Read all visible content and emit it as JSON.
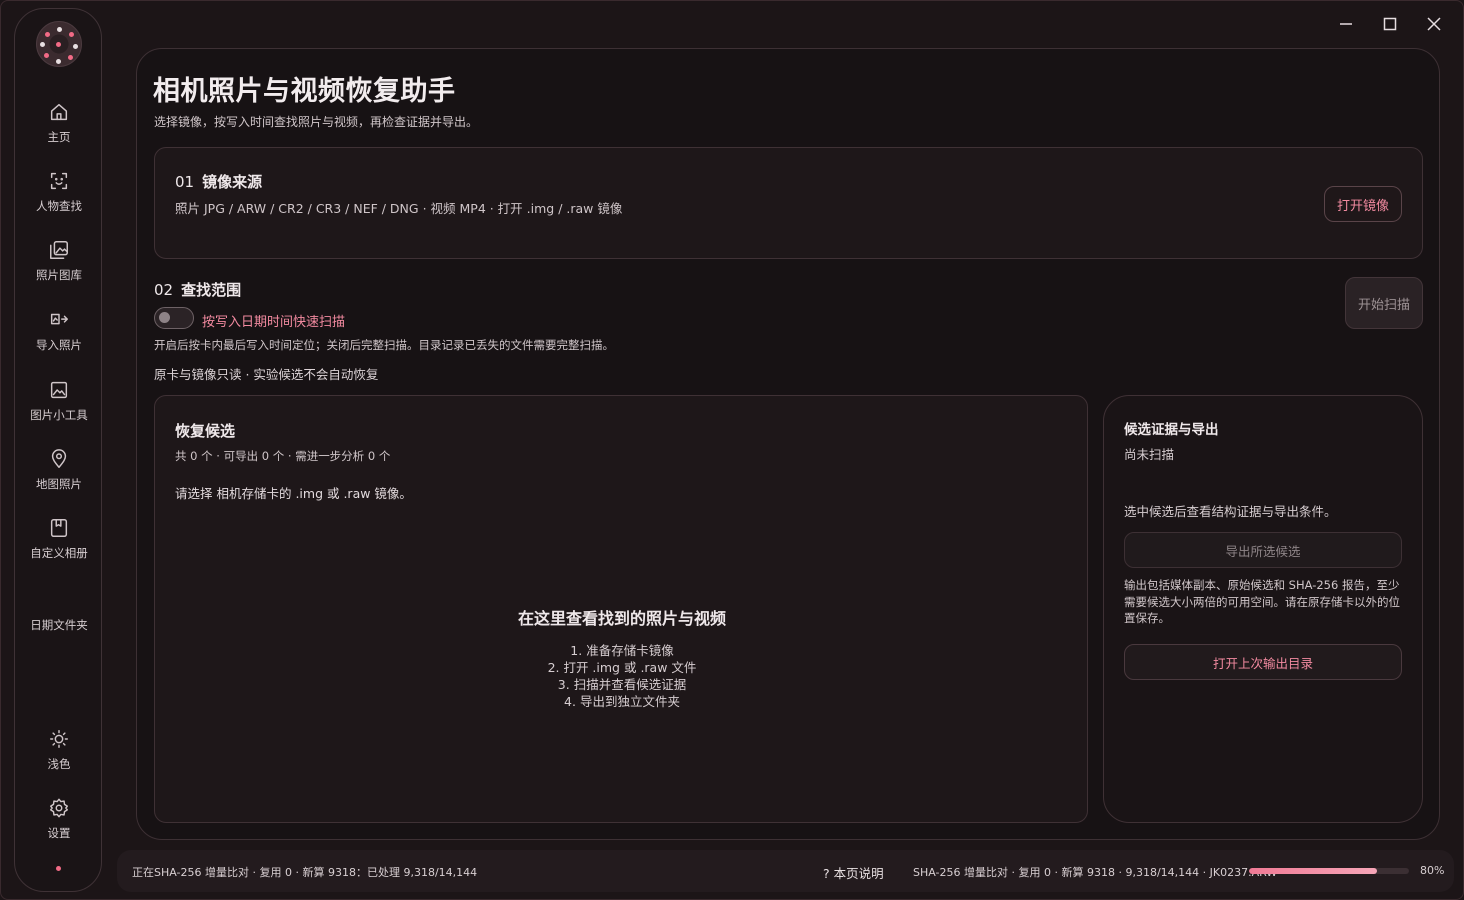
{
  "sidebar": {
    "items": [
      {
        "label": "主页",
        "icon": "home-icon"
      },
      {
        "label": "人物查找",
        "icon": "face-scan-icon"
      },
      {
        "label": "照片图库",
        "icon": "gallery-icon"
      },
      {
        "label": "导入照片",
        "icon": "import-icon"
      },
      {
        "label": "图片小工具",
        "icon": "image-tool-icon"
      },
      {
        "label": "地图照片",
        "icon": "map-pin-icon"
      },
      {
        "label": "自定义相册",
        "icon": "album-icon"
      },
      {
        "label": "日期文件夹",
        "icon": ""
      }
    ],
    "bottom": [
      {
        "label": "浅色",
        "icon": "sun-icon"
      },
      {
        "label": "设置",
        "icon": "gear-icon"
      }
    ]
  },
  "page": {
    "title": "相机照片与视频恢复助手",
    "subtitle": "选择镜像，按写入时间查找照片与视频，再检查证据并导出。"
  },
  "source": {
    "num": "01",
    "title": "镜像来源",
    "desc": "照片 JPG / ARW / CR2 / CR3 / NEF / DNG · 视频 MP4 · 打开 .img / .raw 镜像",
    "open_button": "打开镜像"
  },
  "scope": {
    "num": "02",
    "title": "查找范围",
    "toggle_label": "按写入日期时间快速扫描",
    "toggle_on": false,
    "hint": "开启后按卡内最后写入时间定位；关闭后完整扫描。目录记录已丢失的文件需要完整扫描。",
    "note": "原卡与镜像只读 · 实验候选不会自动恢复",
    "scan_button": "开始扫描"
  },
  "candidates": {
    "title": "恢复候选",
    "counts": "共 0 个 · 可导出 0 个 · 需进一步分析 0 个",
    "prompt": "请选择 相机存储卡的 .img 或 .raw 镜像。",
    "empty_title": "在这里查看找到的照片与视频",
    "steps": [
      "1. 准备存储卡镜像",
      "2. 打开 .img 或 .raw 文件",
      "3. 扫描并查看候选证据",
      "4. 导出到独立文件夹"
    ]
  },
  "evidence": {
    "title": "候选证据与导出",
    "status": "尚未扫描",
    "hint": "选中候选后查看结构证据与导出条件。",
    "export_button": "导出所选候选",
    "export_note": "输出包括媒体副本、原始候选和 SHA-256 报告，至少需要候选大小两倍的可用空间。请在原存储卡以外的位置保存。",
    "open_last_button": "打开上次输出目录"
  },
  "statusbar": {
    "left": "正在SHA-256 增量比对 · 复用 0 · 新算 9318：已处理 9,318/14,144",
    "help": "? 本页说明",
    "right": "SHA-256 增量比对 · 复用 0 · 新算 9318 · 9,318/14,144 · JK0237.ARW",
    "progress_percent": 80,
    "progress_label": "80%"
  },
  "colors": {
    "accent": "#f28aa0",
    "background": "#1c1517",
    "panel": "#171214"
  }
}
